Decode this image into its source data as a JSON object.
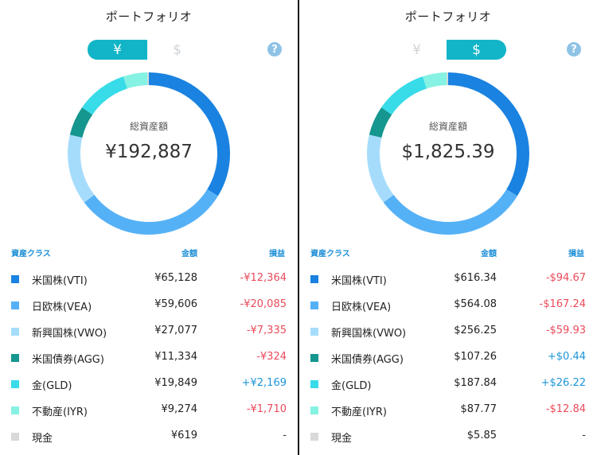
{
  "panels": [
    {
      "title": "ポートフォリオ",
      "toggle": {
        "yen": "¥",
        "usd": "$",
        "active": "yen"
      },
      "help": "?",
      "center_label": "総資産額",
      "center_value": "¥192,887",
      "headers": {
        "asset_class": "資産クラス",
        "amount": "金額",
        "pl": "損益"
      },
      "rows": [
        {
          "name": "米国株(VTI)",
          "amount": "¥65,128",
          "pl": "-¥12,364",
          "sign": "neg"
        },
        {
          "name": "日欧株(VEA)",
          "amount": "¥59,606",
          "pl": "-¥20,085",
          "sign": "neg"
        },
        {
          "name": "新興国株(VWO)",
          "amount": "¥27,077",
          "pl": "-¥7,335",
          "sign": "neg"
        },
        {
          "name": "米国債券(AGG)",
          "amount": "¥11,334",
          "pl": "-¥324",
          "sign": "neg"
        },
        {
          "name": "金(GLD)",
          "amount": "¥19,849",
          "pl": "+¥2,169",
          "sign": "pos"
        },
        {
          "name": "不動産(IYR)",
          "amount": "¥9,274",
          "pl": "-¥1,710",
          "sign": "neg"
        },
        {
          "name": "現金",
          "amount": "¥619",
          "pl": "-",
          "sign": "neu"
        }
      ]
    },
    {
      "title": "ポートフォリオ",
      "toggle": {
        "yen": "¥",
        "usd": "$",
        "active": "usd"
      },
      "help": "?",
      "center_label": "総資産額",
      "center_value": "$1,825.39",
      "headers": {
        "asset_class": "資産クラス",
        "amount": "金額",
        "pl": "損益"
      },
      "rows": [
        {
          "name": "米国株(VTI)",
          "amount": "$616.34",
          "pl": "-$94.67",
          "sign": "neg"
        },
        {
          "name": "日欧株(VEA)",
          "amount": "$564.08",
          "pl": "-$167.24",
          "sign": "neg"
        },
        {
          "name": "新興国株(VWO)",
          "amount": "$256.25",
          "pl": "-$59.93",
          "sign": "neg"
        },
        {
          "name": "米国債券(AGG)",
          "amount": "$107.26",
          "pl": "+$0.44",
          "sign": "pos"
        },
        {
          "name": "金(GLD)",
          "amount": "$187.84",
          "pl": "+$26.22",
          "sign": "pos"
        },
        {
          "name": "不動産(IYR)",
          "amount": "$87.77",
          "pl": "-$12.84",
          "sign": "neg"
        },
        {
          "name": "現金",
          "amount": "$5.85",
          "pl": "-",
          "sign": "neu"
        }
      ]
    }
  ],
  "asset_colors": [
    "#1a82e0",
    "#55b1f6",
    "#a6dcfb",
    "#15968f",
    "#38dbe8",
    "#86f2e3",
    "#d9d9d9"
  ],
  "allocation_fractions": [
    0.3376,
    0.309,
    0.1404,
    0.0588,
    0.1029,
    0.0481,
    0.0032
  ]
}
